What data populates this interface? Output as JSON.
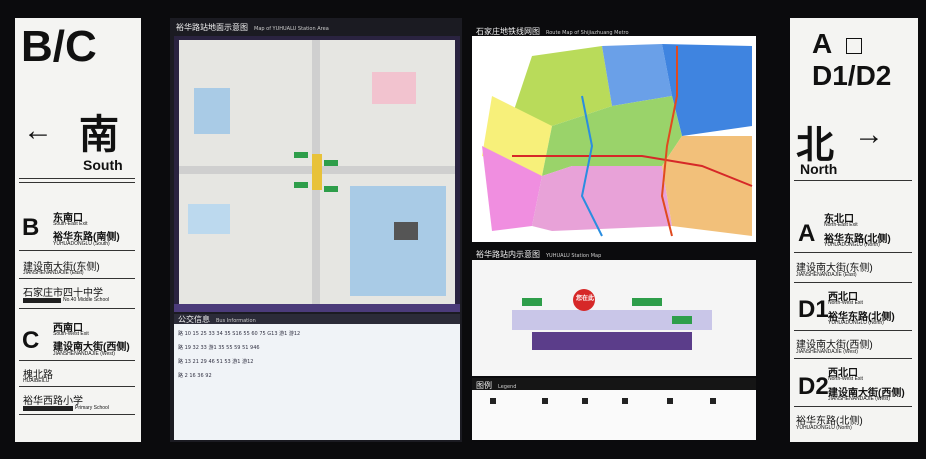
{
  "left_sign": {
    "exits": "B/C",
    "direction_cn": "南",
    "direction_en": "South",
    "arrow": "←",
    "exit_b": {
      "letter": "B",
      "title": "东南口",
      "title_en": "South-East Exit",
      "road": "裕华东路(南侧)",
      "road_en": "YUHUADONGLU (South)"
    },
    "dest1": {
      "cn": "建设南大街(东侧)",
      "en": "JIANSHENANDAJIE (East)"
    },
    "dest2": {
      "cn": "石家庄市四十中学",
      "en": "No.40 Middle School"
    },
    "exit_c": {
      "letter": "C",
      "title": "西南口",
      "title_en": "South-West Exit",
      "road": "建设南大街(西侧)",
      "road_en": "JIANSHENANDAJIE (West)"
    },
    "dest3": {
      "cn": "槐北路",
      "en": "HUAIBEILU"
    },
    "dest4": {
      "cn": "裕华西路小学",
      "en": "Primary School"
    }
  },
  "right_sign": {
    "exit_a": "A",
    "exit_d": "D1/D2",
    "direction_cn": "北",
    "direction_en": "North",
    "arrow": "→",
    "exit_a_info": {
      "letter": "A",
      "title": "东北口",
      "title_en": "North-East Exit",
      "road": "裕华东路(北侧)",
      "road_en": "YUHUADONGLU (North)"
    },
    "dest1": {
      "cn": "建设南大街(东侧)",
      "en": "JIANSHENANDAJIE (East)"
    },
    "exit_d1": {
      "letter": "D1",
      "title": "西北口",
      "title_en": "North-West Exit",
      "road": "裕华东路(北侧)",
      "road_en": "YUHUADONGLU (North)"
    },
    "dest2": {
      "cn": "建设南大街(西侧)",
      "en": "JIANSHENANDAJIE (West)"
    },
    "exit_d2": {
      "letter": "D2",
      "title": "西北口",
      "title_en": "North-West Exit",
      "road": "建设南大街(西侧)",
      "road_en": "JIANSHENANDAJIE (West)"
    },
    "dest3": {
      "cn": "裕华东路(北侧)",
      "en": "YUHUADONGLU (North)"
    }
  },
  "area_map": {
    "title_cn": "裕华路站地面示意图",
    "title_en": "Map of YUHUALU Station Area"
  },
  "bus_info": {
    "title_cn": "公交信息",
    "title_en": "Bus Information",
    "rows": [
      "路 10 15 25 33 34 35 S16 55 60 75 G13 游1 游12",
      "路 19 32 33 游1 35 55 59 51 946",
      "路 13 21 29 46 51 53 游1 游12",
      "路 2 16 36 92"
    ]
  },
  "route_map": {
    "title_cn": "石家庄地铁线网图",
    "title_en": "Route Map of Shijiazhuang Metro"
  },
  "station_map": {
    "title_cn": "裕华路站内示意图",
    "title_en": "YUHUALU Station Map",
    "label": "您在此"
  },
  "legend": {
    "title_cn": "图例",
    "title_en": "Legend"
  }
}
